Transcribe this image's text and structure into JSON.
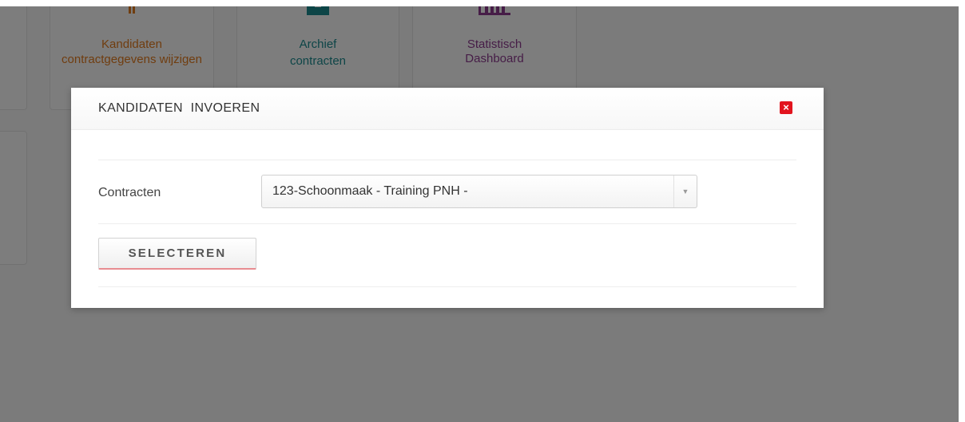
{
  "tiles": [
    {
      "line1": "Kandidaten",
      "line2": "contractgegevens wijzigen"
    },
    {
      "line1": "Archief",
      "line2": "contracten"
    },
    {
      "line1": "Statistisch",
      "line2": "Dashboard"
    }
  ],
  "colors": {
    "kandidaten": "#e07a1f",
    "archief": "#1b8a8f",
    "statistisch": "#8c3b8e",
    "close": "#e2141e",
    "button_accent": "#e88c91"
  },
  "modal": {
    "title": "KANDIDATEN  INVOEREN",
    "close_icon": "close-icon",
    "contract_label": "Contracten",
    "contract_selected": "123-Schoonmaak - Training PNH -",
    "select_button": "SELECTEREN"
  }
}
